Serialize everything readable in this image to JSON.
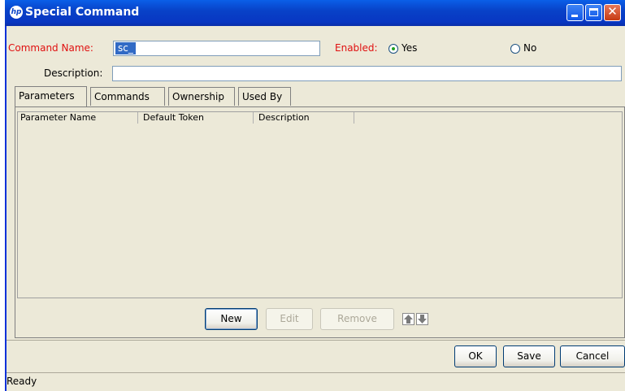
{
  "window": {
    "title": "Special Command",
    "logo_text": "hp"
  },
  "form": {
    "command_name_label": "Command Name:",
    "command_name_value": "sc_",
    "enabled_label": "Enabled:",
    "yes_label": "Yes",
    "no_label": "No",
    "enabled_selected": "Yes",
    "description_label": "Description:",
    "description_value": ""
  },
  "tabs": [
    {
      "label": "Parameters",
      "active": true
    },
    {
      "label": "Commands",
      "active": false
    },
    {
      "label": "Ownership",
      "active": false
    },
    {
      "label": "Used By",
      "active": false
    }
  ],
  "table": {
    "columns": [
      "Parameter Name",
      "Default Token",
      "Description"
    ],
    "rows": []
  },
  "panel_buttons": {
    "new": "New",
    "edit": "Edit",
    "remove": "Remove"
  },
  "dialog_buttons": {
    "ok": "OK",
    "save": "Save",
    "cancel": "Cancel"
  },
  "status": {
    "text": "Ready"
  },
  "icons": {
    "move_up": "arrow-up-icon",
    "move_down": "arrow-down-icon"
  }
}
